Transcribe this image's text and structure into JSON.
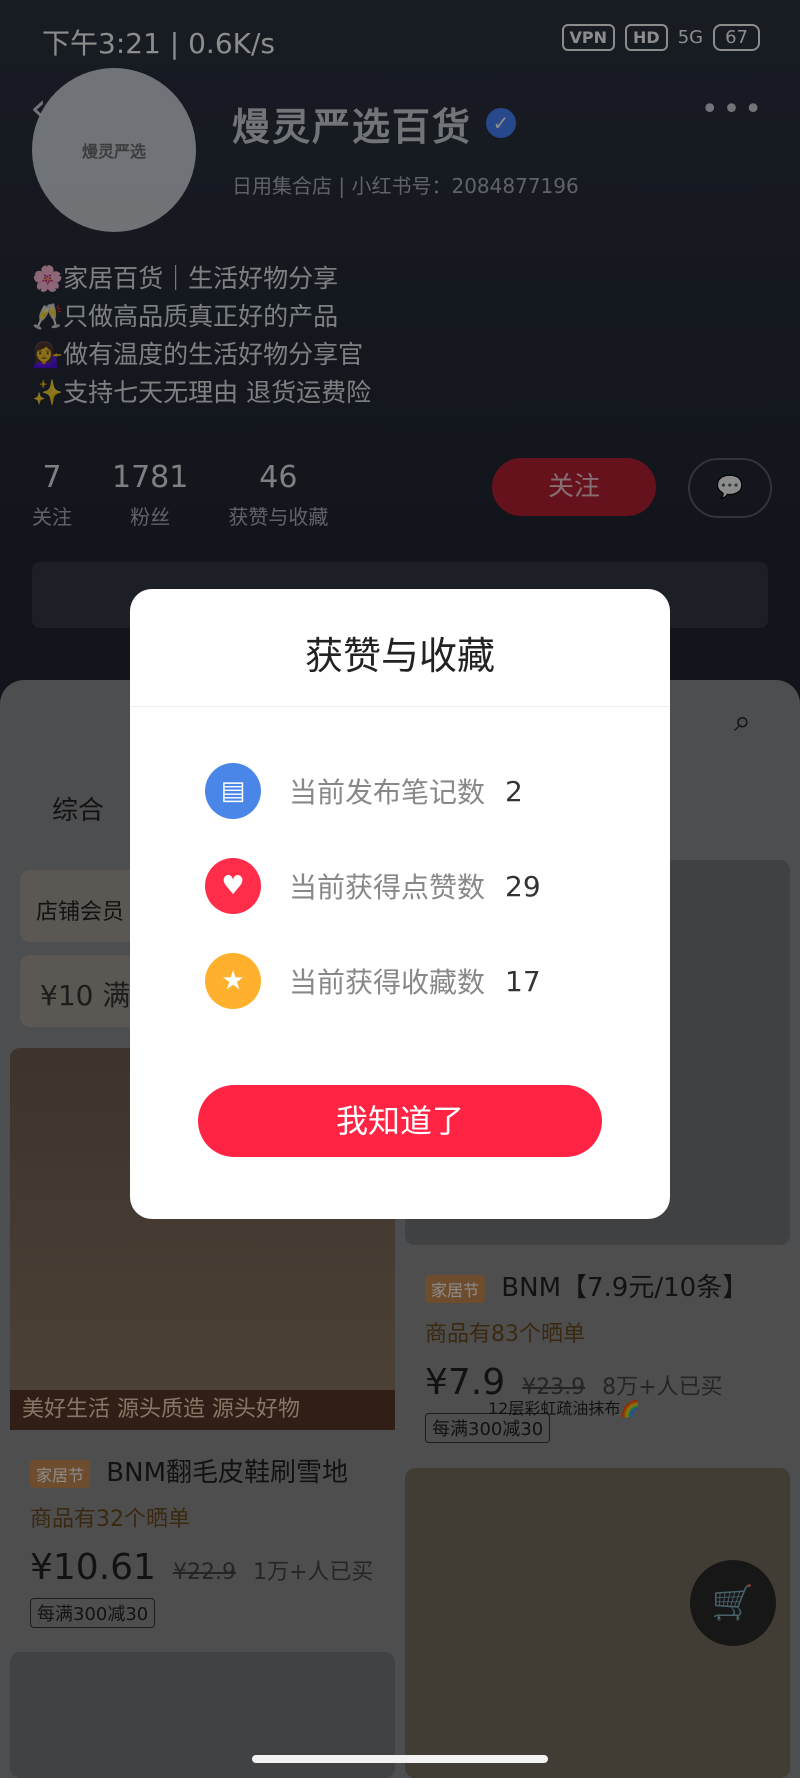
{
  "status_bar": {
    "time_text": "下午3:21 | 0.6K/s",
    "vpn": "VPN",
    "hd": "HD",
    "network": "5G",
    "battery": "67"
  },
  "profile": {
    "shop_name": "熳灵严选百货",
    "avatar_text": "熳灵严选",
    "category": "日用集合店",
    "xhs_id_label": "小红书号：2084877196",
    "bio_lines": [
      "🌸家居百货｜生活好物分享",
      "🥂只做高品质真正好的产品",
      "💁‍♀️做有温度的生活好物分享官",
      "✨支持七天无理由 退货运费险"
    ],
    "stats": [
      {
        "num": "7",
        "label": "关注"
      },
      {
        "num": "1781",
        "label": "粉丝"
      },
      {
        "num": "46",
        "label": "获赞与收藏"
      }
    ],
    "follow_label": "关注"
  },
  "content": {
    "tab_label": "综合",
    "member_label": "店铺会员",
    "coupon_text": "¥10 满",
    "left_banner": "美好生活 源头质造  源头好物",
    "left_product": {
      "tag": "家居节",
      "title": "BNM翻毛皮鞋刷雪地",
      "sub": "商品有32个晒单",
      "price_main": "¥10.61",
      "price_old": "¥22.9",
      "sold": "1万+人已买",
      "promo": "每满300减30"
    },
    "right_product": {
      "tag": "家居节",
      "title": "BNM【7.9元/10条】",
      "sub": "商品有83个晒单",
      "price_main": "¥7.9",
      "price_old": "¥23.9",
      "sold": "8万+人已买",
      "promo": "每满300减30"
    },
    "rainbow_label": "12层彩虹疏油抹布🌈"
  },
  "modal": {
    "title": "获赞与收藏",
    "rows": [
      {
        "label": "当前发布笔记数",
        "value": "2",
        "icon": "note-icon",
        "color": "#4a86e8"
      },
      {
        "label": "当前获得点赞数",
        "value": "29",
        "icon": "heart-icon",
        "color": "#ff2d4a"
      },
      {
        "label": "当前获得收藏数",
        "value": "17",
        "icon": "star-icon",
        "color": "#ffb12e"
      }
    ],
    "ok_label": "我知道了"
  }
}
